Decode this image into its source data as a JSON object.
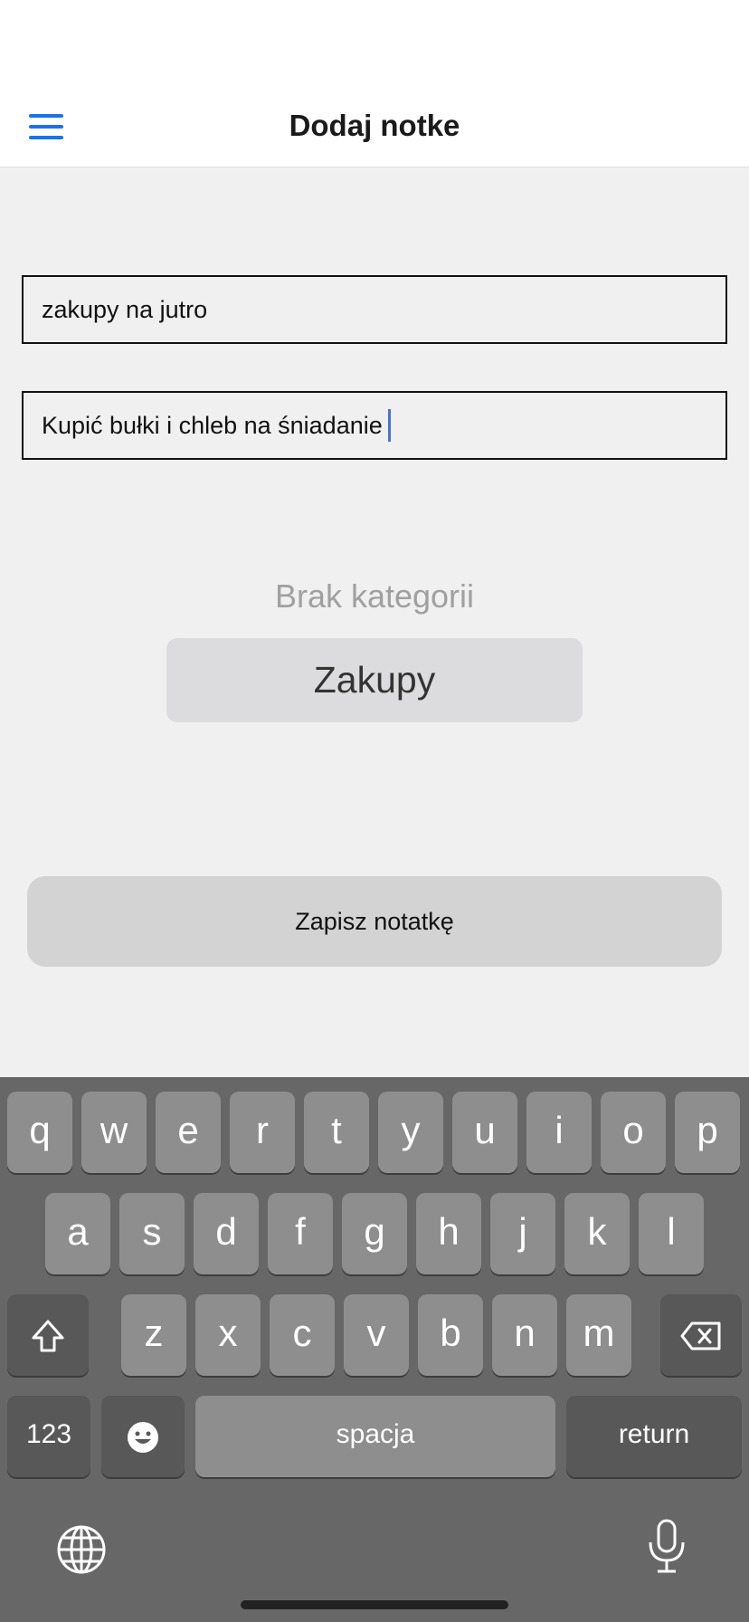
{
  "header": {
    "title": "Dodaj notke"
  },
  "form": {
    "title_value": "zakupy na jutro",
    "body_value": "Kupić bułki i chleb na śniadanie"
  },
  "category_picker": {
    "above_option": "Brak kategorii",
    "selected": "Zakupy"
  },
  "save_label": "Zapisz notatkę",
  "keyboard": {
    "row1": [
      "q",
      "w",
      "e",
      "r",
      "t",
      "y",
      "u",
      "i",
      "o",
      "p"
    ],
    "row2": [
      "a",
      "s",
      "d",
      "f",
      "g",
      "h",
      "j",
      "k",
      "l"
    ],
    "row3": [
      "z",
      "x",
      "c",
      "v",
      "b",
      "n",
      "m"
    ],
    "numbers_label": "123",
    "space_label": "spacja",
    "return_label": "return",
    "icons": [
      "menu-icon",
      "shift-icon",
      "backspace-icon",
      "emoji-icon",
      "globe-icon",
      "microphone-icon"
    ]
  },
  "colors": {
    "accent": "#1a73e8",
    "caret": "#4a6fe0",
    "keyboard_bg": "#676767"
  }
}
